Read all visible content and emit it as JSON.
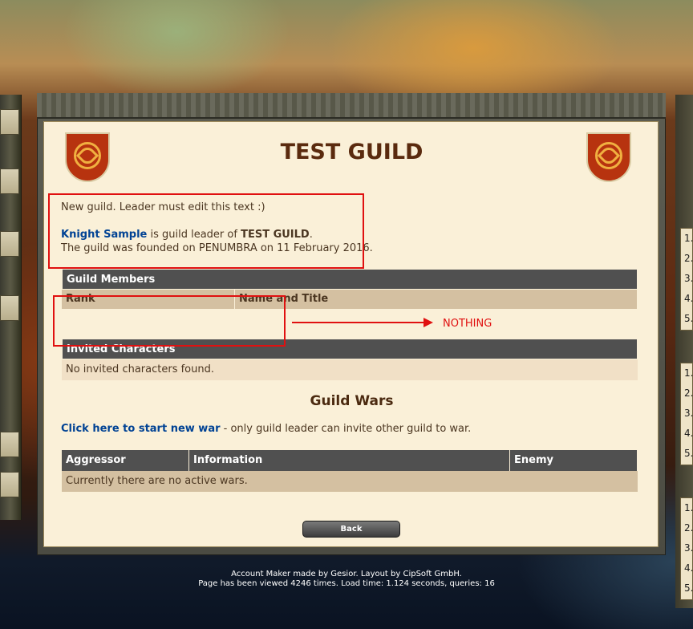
{
  "guild": {
    "name": "TEST GUILD",
    "description": "New guild. Leader must edit this text :)",
    "leader": "Knight Sample",
    "leader_suffix": " is guild leader of ",
    "leader_guild": "TEST GUILD",
    "leader_end": ".",
    "founded": "The guild was founded on PENUMBRA on 11 February 2016."
  },
  "members_table": {
    "header": "Guild Members",
    "columns": [
      "Rank",
      "Name and Title"
    ]
  },
  "invited_table": {
    "header": "Invited Characters",
    "empty": "No invited characters found."
  },
  "wars": {
    "heading": "Guild Wars",
    "start_link": "Click here to start new war",
    "start_note": " - only guild leader can invite other guild to war.",
    "columns": [
      "Aggressor",
      "Information",
      "Enemy"
    ],
    "empty": "Currently there are no active wars."
  },
  "back_button": "Back",
  "annotation": {
    "label": "NOTHING",
    "color": "#e01010"
  },
  "footer": {
    "line1": "Account Maker made by Gesior. Layout by CipSoft GmbH.",
    "line2": "Page has been viewed 4246 times. Load time: 1.124 seconds, queries: 16"
  },
  "right_list": {
    "items": [
      "1.",
      "2.",
      "3.",
      "4.",
      "5."
    ]
  },
  "colors": {
    "link": "#004294",
    "header_bg": "#505050",
    "row_bg": "#f1e0c6",
    "page_bg": "#faf0d8",
    "title": "#5a2a0e"
  }
}
